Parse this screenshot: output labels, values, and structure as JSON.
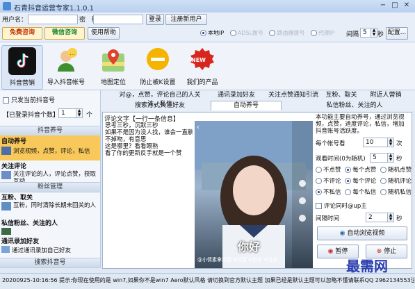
{
  "window": {
    "title": "石青抖音运营专家1.1.0.1",
    "controls": [
      "−",
      "□",
      "✕"
    ]
  },
  "login": {
    "user_label": "用户名：",
    "password_label": "密　码：",
    "login_btn": "登录",
    "register_btn": "注册新用户"
  },
  "toolbar": {
    "free_consult": "免费咨询",
    "wechat_consult": "微信咨询",
    "help": "使用帮助",
    "proxy_options": [
      "本地IP",
      "ADSL拨号",
      "路由器拨号",
      "代理IP"
    ],
    "interval_label": "间隔",
    "interval_value": "5",
    "unit": "秒",
    "config_btn": "配置..."
  },
  "features": [
    "抖音营销",
    "导入抖音帐号",
    "地图定位",
    "防止被K设置",
    "我们的产品"
  ],
  "new_badge": "NEW",
  "sidebar": {
    "only_current": "只发当前抖音号",
    "logged_count_label": "【已登录抖音个数】",
    "logged_count_value": "1",
    "count_unit": "个",
    "section1": "抖音养号",
    "items": [
      {
        "title": "自动养号",
        "desc": "浏览视频，点赞，评论，私信"
      },
      {
        "title": "关注评论",
        "desc": "关注评论的人，评论点赞，获取互动"
      }
    ],
    "section2": "粉丝管理",
    "items2": [
      {
        "title": "互粉、取关",
        "desc": "互粉，同时清除长期未回关的人"
      },
      {
        "title": "私信粉丝、关注的人",
        "desc": ""
      },
      {
        "title": "通讯录加好友",
        "desc": "通过通讯录加自己好友"
      }
    ],
    "section3": "搜索抖音号"
  },
  "tabs": {
    "row1": [
      "对@，点赞，评论自己的人关注、私信",
      "通讯录加好友",
      "关注点赞通知引流",
      "互粉、取关",
      "附近人营销"
    ],
    "row2": [
      "搜索方式关注好友",
      "自动养号",
      "私信粉丝、关注的人"
    ],
    "active": "自动养号"
  },
  "comment_panel": {
    "header": "评论文字【一行一条信息】",
    "lines": [
      "思考三秒，沉默三秒",
      "如果不是因为没人找，谁会一直躺着",
      "不掉吻，有意思",
      "这是哪里？看看眼熟",
      "看了你的更新反手就是一个赞"
    ]
  },
  "video": {
    "caption": "你好",
    "hashtags": "@小情素拿抖音 #抖音 #日本 #日本..."
  },
  "settings": {
    "desc": "本功能主要自动养号，通过浏览视频，点赞，适度评论，私信，增加抖音账号活跃度。",
    "per_account_label": "每个帐号看",
    "per_account_value": "10",
    "per_account_unit": "次",
    "watch_time_label": "观看时间(0为随机)",
    "watch_time_value": "5",
    "watch_time_unit": "秒",
    "like_opts": [
      "不点赞",
      "每个点赞",
      "随机点赞"
    ],
    "comment_opts": [
      "不评论",
      "每个评论",
      "随机评论"
    ],
    "msg_opts": [
      "不私信",
      "每个私信",
      "随机私信"
    ],
    "at_label": "评论同时@up主",
    "at_value": "1",
    "interval_label": "间隔时间",
    "interval_value": "2",
    "interval_unit": "秒",
    "auto_btn": "自动浏览视频",
    "pause_btn": "暂停",
    "stop_btn": "停止"
  },
  "status": {
    "text": "20200925-10:16:56  提示:你现在使用的是 win7,如果你不是win7 Aero默认风格 请切换到官方默认主题 加果已经是默认主题可以忽略不懂请联系QQ 2962134553注打开详解"
  },
  "watermark": "最需网"
}
